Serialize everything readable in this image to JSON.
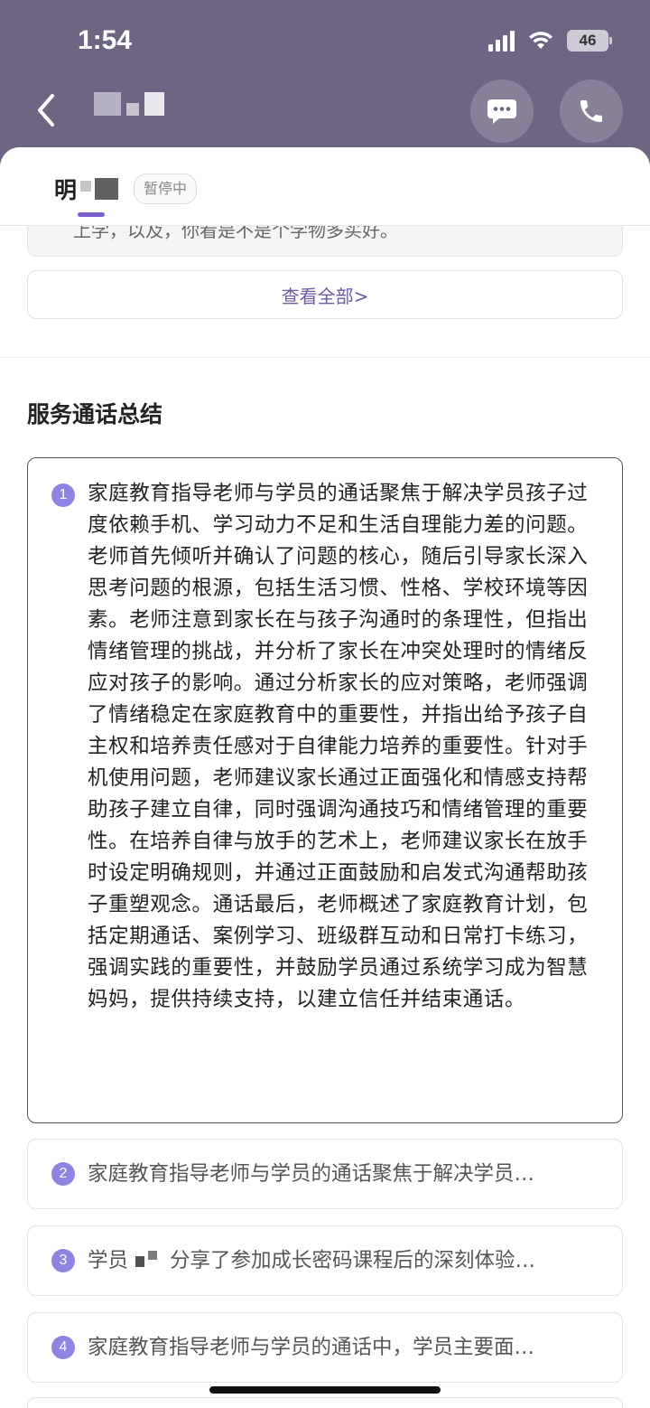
{
  "status_bar": {
    "time": "1:54",
    "battery": "46"
  },
  "header": {
    "contact_name": ""
  },
  "tab": {
    "name_prefix": "明",
    "status_badge": "暂停中"
  },
  "previous_card": {
    "text": "上学，以及，你看是不是个学物多买好。"
  },
  "view_all": "查看全部>",
  "section": {
    "title": "服务通话总结"
  },
  "summaries": [
    {
      "index": "1",
      "text": "家庭教育指导老师与学员的通话聚焦于解决学员孩子过度依赖手机、学习动力不足和生活自理能力差的问题。老师首先倾听并确认了问题的核心，随后引导家长深入思考问题的根源，包括生活习惯、性格、学校环境等因素。老师注意到家长在与孩子沟通时的条理性，但指出情绪管理的挑战，并分析了家长在冲突处理时的情绪反应对孩子的影响。通过分析家长的应对策略，老师强调了情绪稳定在家庭教育中的重要性，并指出给予孩子自主权和培养责任感对于自律能力培养的重要性。针对手机使用问题，老师建议家长通过正面强化和情感支持帮助孩子建立自律，同时强调沟通技巧和情绪管理的重要性。在培养自律与放手的艺术上，老师建议家长在放手时设定明确规则，并通过正面鼓励和启发式沟通帮助孩子重塑观念。通话最后，老师概述了家庭教育计划，包括定期通话、案例学习、班级群互动和日常打卡练习，强调实践的重要性，并鼓励学员通过系统学习成为智慧妈妈，提供持续支持，以建立信任并结束通话。"
    },
    {
      "index": "2",
      "text": "家庭教育指导老师与学员的通话聚焦于解决学员…"
    },
    {
      "index": "3",
      "text_prefix": "学员",
      "text_suffix": "分享了参加成长密码课程后的深刻体验…"
    },
    {
      "index": "4",
      "text": "家庭教育指导老师与学员的通话中，学员主要面…"
    }
  ]
}
